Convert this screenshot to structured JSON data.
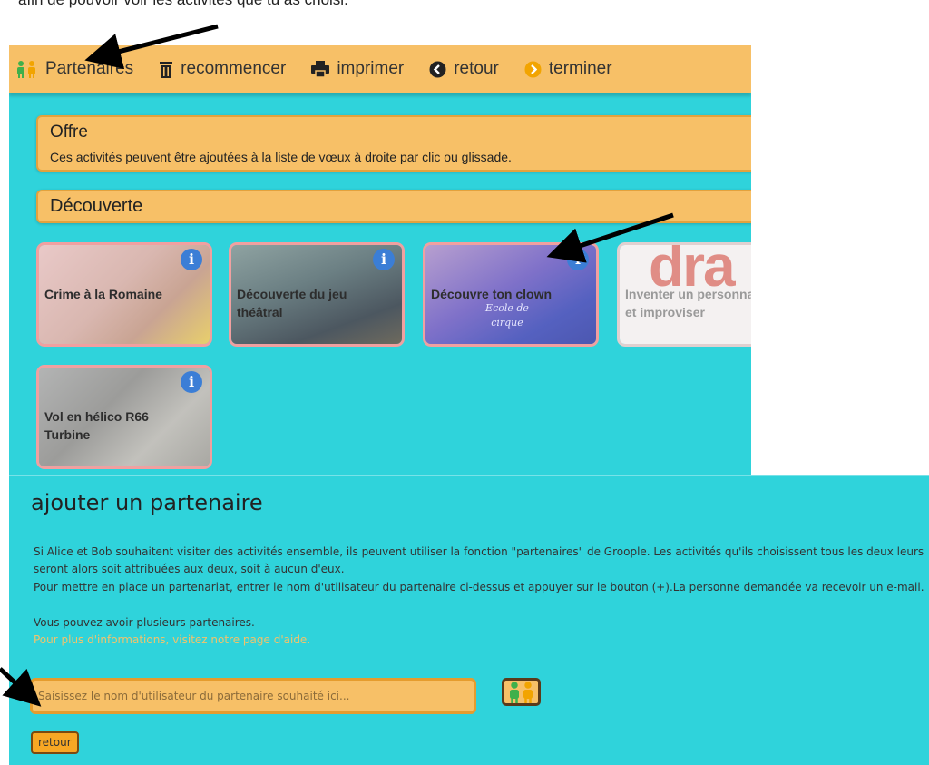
{
  "intro": {
    "text": "afin de pouvoir voir les activités que tu as choisi."
  },
  "toolbar": {
    "items": [
      {
        "label": "Partenaires",
        "icon": "partners-icon"
      },
      {
        "label": "recommencer",
        "icon": "trash-icon"
      },
      {
        "label": "imprimer",
        "icon": "printer-icon"
      },
      {
        "label": "retour",
        "icon": "back-circle-icon"
      },
      {
        "label": "terminer",
        "icon": "finish-circle-icon"
      }
    ]
  },
  "offre": {
    "title": "Offre",
    "description": "Ces activités peuvent être ajoutées à la liste de vœux à droite par clic ou glissade."
  },
  "decouverte": {
    "title": "Découverte"
  },
  "activities": [
    {
      "name": "Crime à la Romaine"
    },
    {
      "name": "Découverte du jeu théâtral"
    },
    {
      "name": "Découvre ton clown",
      "image_text": "Ecole de cirque"
    },
    {
      "name": "Inventer un personnage et improviser",
      "image_text": "dra"
    },
    {
      "name": "Vol en hélico R66 Turbine"
    }
  ],
  "partner_dialog": {
    "title": "ajouter un partenaire",
    "para1": "Si Alice et Bob souhaitent visiter des activités ensemble, ils peuvent utiliser la fonction \"partenaires\" de Groople. Les activités qu'ils choisissent tous les deux leurs seront alors soit attribuées aux deux, soit à aucun d'eux.",
    "para2": "Pour mettre en place un partenariat, entrer le nom d'utilisateur du partenaire ci-dessus et appuyer sur le bouton (+).La personne demandée va recevoir un e-mail.",
    "para3": "Vous pouvez avoir plusieurs partenaires.",
    "help_link": "Pour plus d'informations, visitez notre page d'aide.",
    "input_placeholder": "Saisissez le nom d'utilisateur du partenaire souhaité ici...",
    "back_label": "retour"
  },
  "colors": {
    "teal": "#2fd3db",
    "orange": "#f7c067",
    "info_blue": "#3b7ed6"
  }
}
